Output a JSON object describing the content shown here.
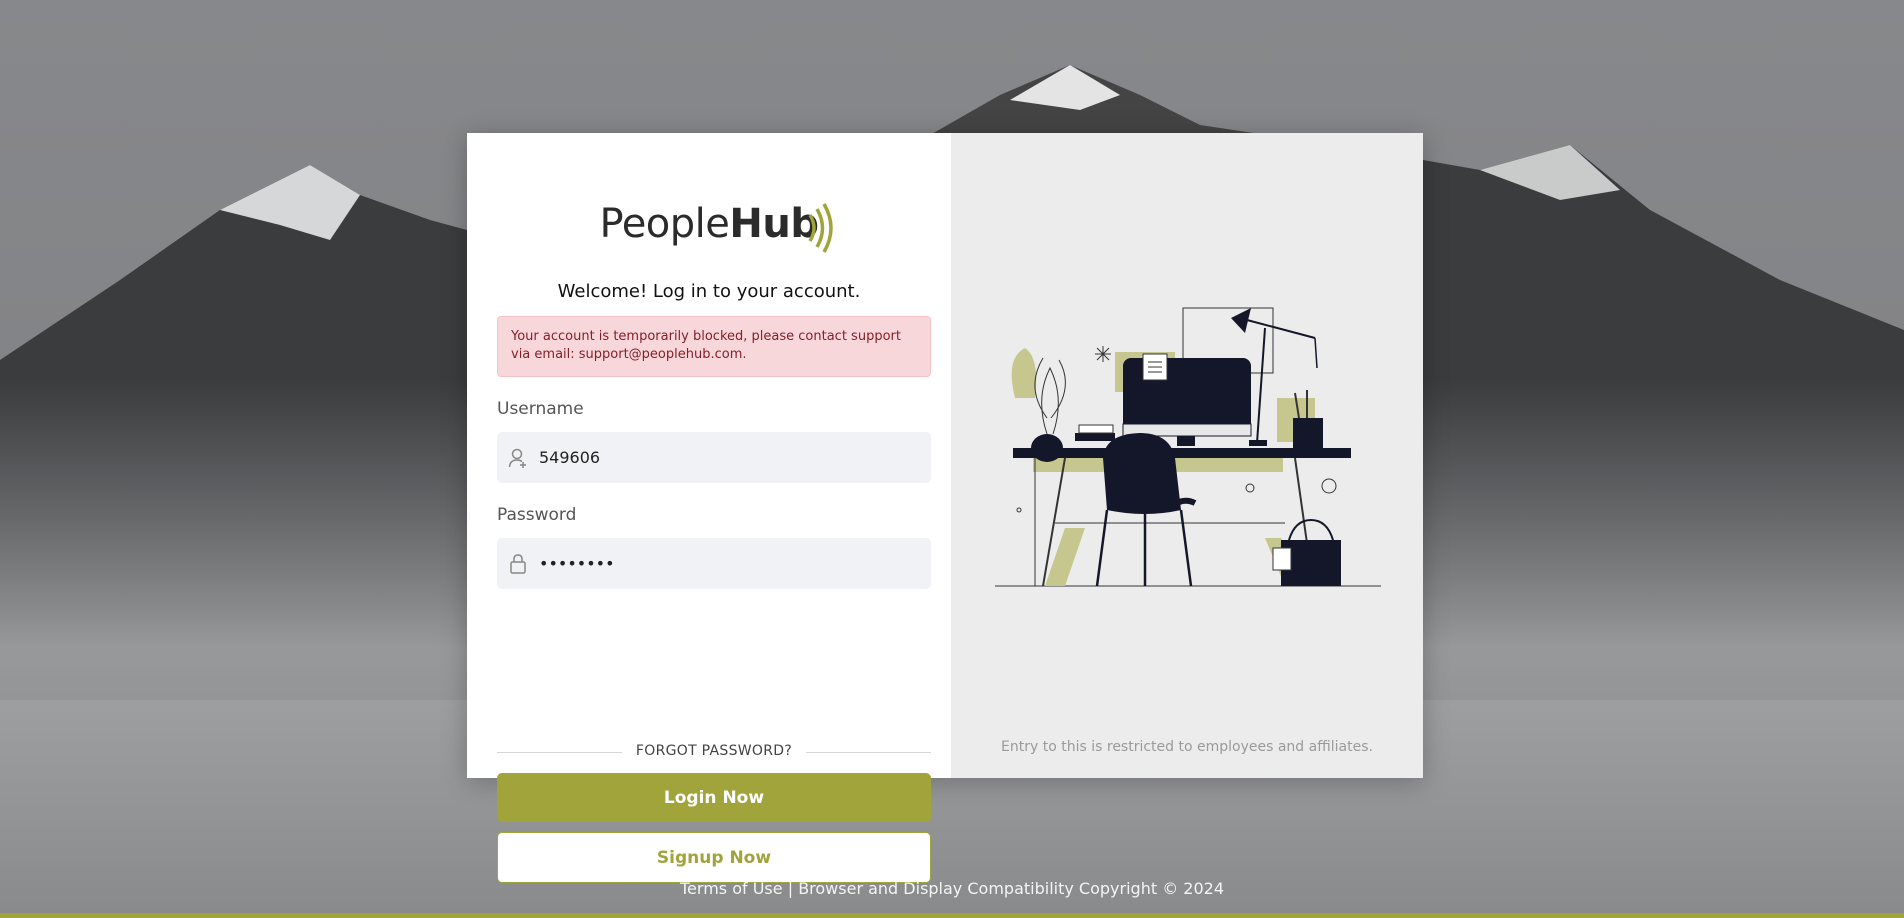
{
  "brand": {
    "name_light": "People",
    "name_bold": "Hub",
    "accent_color": "#a0a43a"
  },
  "login": {
    "welcome": "Welcome! Log in to your account.",
    "alert": "Your account is temporarily blocked, please contact support via email: support@peoplehub.com.",
    "username_label": "Username",
    "username_value": "549606",
    "username_icon": "user-plus-icon",
    "password_label": "Password",
    "password_value": "••••••••",
    "password_icon": "lock-icon",
    "forgot_password": "FORGOT PASSWORD?",
    "login_button": "Login Now",
    "signup_button": "Signup Now"
  },
  "side_panel": {
    "notice": "Entry to this is restricted to employees and affiliates."
  },
  "footer": {
    "terms": "Terms of Use",
    "separator": "|",
    "compat": "Browser and Display Compatibility",
    "copyright": "Copyright © 2024"
  }
}
